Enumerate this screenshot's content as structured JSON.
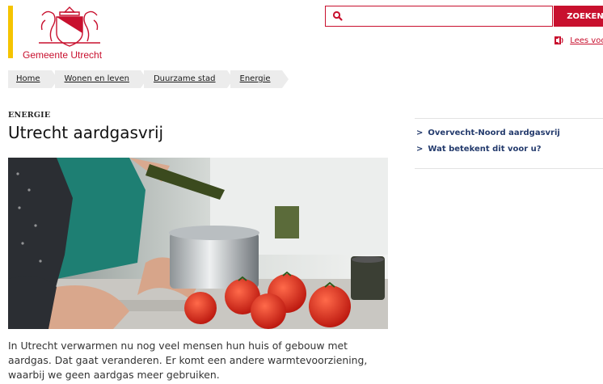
{
  "header": {
    "logo_text": "Gemeente Utrecht",
    "brand_color": "#c8102e",
    "accent_bar_color": "#f5c400"
  },
  "search": {
    "placeholder": "",
    "button_label": "ZOEKEN",
    "icon": "search-icon"
  },
  "readspeaker": {
    "label": "Lees voor",
    "icon": "speaker-icon"
  },
  "breadcrumb": {
    "items": [
      "Home",
      "Wonen en leven",
      "Duurzame stad",
      "Energie"
    ]
  },
  "page": {
    "kicker": "ENERGIE",
    "title": "Utrecht aardgasvrij",
    "intro": "In Utrecht verwarmen nu nog veel mensen hun huis of gebouw met aardgas. Dat gaat veranderen. Er komt een andere warmtevoorziening, waarbij we geen aardgas meer gebruiken."
  },
  "anchors": {
    "items": [
      "Overvecht-Noord aardgasvrij",
      "Wat betekent dit voor u?"
    ],
    "color": "#243b6d"
  }
}
